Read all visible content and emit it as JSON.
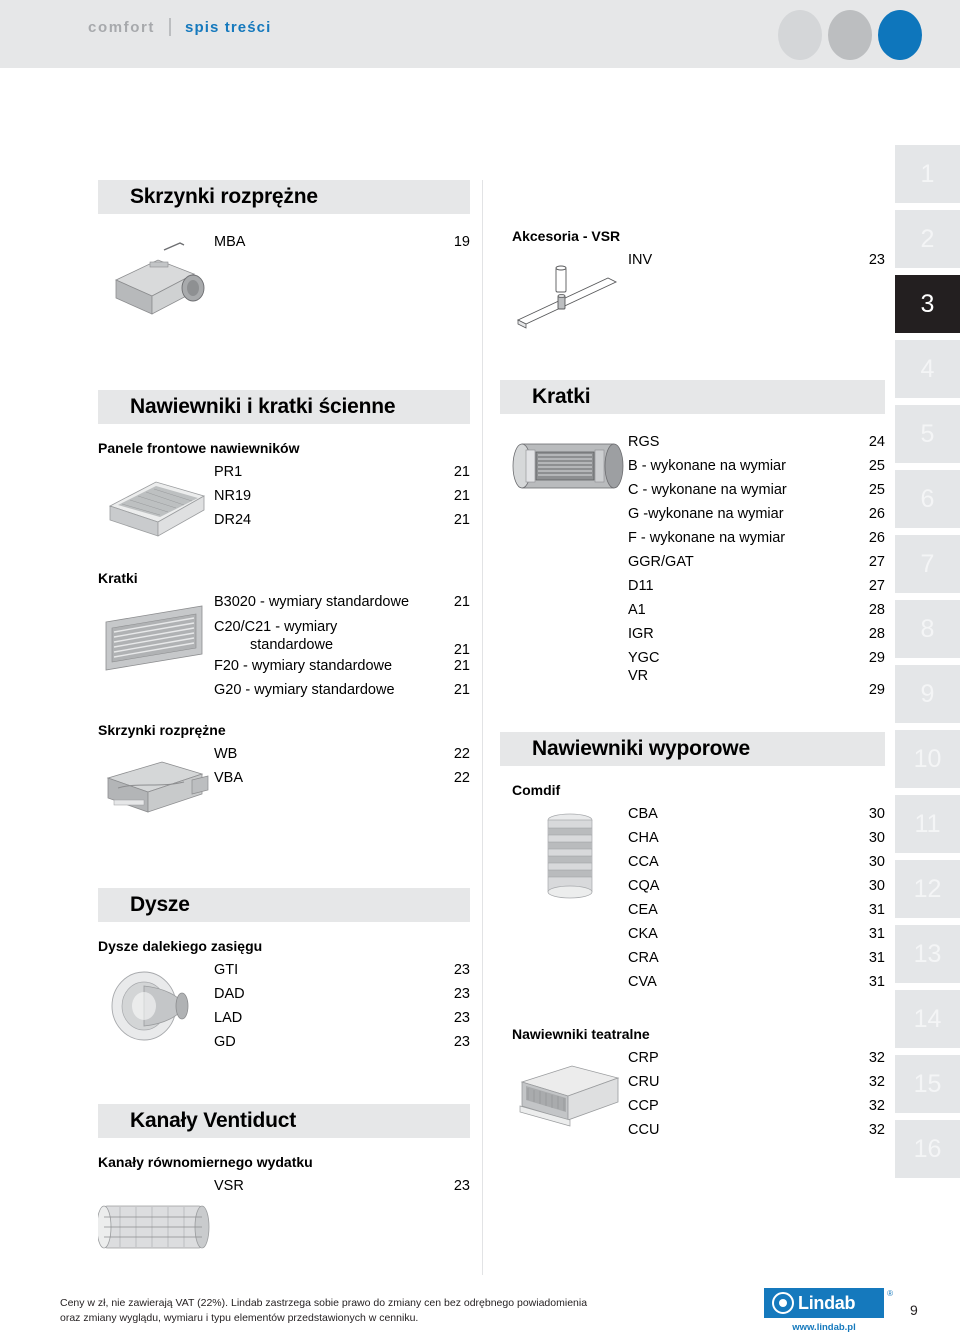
{
  "header": {
    "brand": "comfort",
    "section": "spis treści",
    "dots": [
      {
        "name": "dot-light",
        "color": "#d4d6d8"
      },
      {
        "name": "dot-medium",
        "color": "#bcbec0"
      },
      {
        "name": "dot-blue",
        "color": "#0e76bc"
      }
    ]
  },
  "left_column": [
    {
      "band": "Skrzynki rozprężne",
      "groups": [
        {
          "subhead": null,
          "thumb": "plenum-box-thumb",
          "items": [
            {
              "label": "MBA",
              "page": "19"
            }
          ]
        }
      ]
    },
    {
      "band": "Nawiewniki i kratki ścienne",
      "groups": [
        {
          "subhead": "Panele frontowe nawiewników",
          "thumb": "front-panel-thumb",
          "items": [
            {
              "label": "PR1",
              "page": "21"
            },
            {
              "label": "NR19",
              "page": "21"
            },
            {
              "label": "DR24",
              "page": "21"
            }
          ]
        },
        {
          "subhead": "Kratki",
          "thumb": "wall-grille-thumb",
          "items": [
            {
              "label": "B3020 - wymiary standardowe",
              "page": "21"
            },
            {
              "label": "C20/C21 - wymiary",
              "label_cont": "standardowe",
              "page": "21"
            },
            {
              "label": "F20 - wymiary standardowe",
              "page": "21"
            },
            {
              "label": "G20 - wymiary standardowe",
              "page": "21"
            }
          ]
        },
        {
          "subhead": "Skrzynki rozprężne",
          "thumb": "plenum-box-flat-thumb",
          "items": [
            {
              "label": "WB",
              "page": "22"
            },
            {
              "label": "VBA",
              "page": "22"
            }
          ]
        }
      ]
    },
    {
      "band": "Dysze",
      "groups": [
        {
          "subhead": "Dysze dalekiego zasięgu",
          "thumb": "nozzle-thumb",
          "items": [
            {
              "label": "GTI",
              "page": "23"
            },
            {
              "label": "DAD",
              "page": "23"
            },
            {
              "label": "LAD",
              "page": "23"
            },
            {
              "label": "GD",
              "page": "23"
            }
          ]
        }
      ]
    },
    {
      "band": "Kanały Ventiduct",
      "groups": [
        {
          "subhead": "Kanały równomiernego wydatku",
          "thumb": "textile-duct-thumb",
          "items": [
            {
              "label": "VSR",
              "page": "23"
            }
          ]
        }
      ]
    }
  ],
  "right_column": [
    {
      "band": null,
      "groups": [
        {
          "subhead": "Akcesoria - VSR",
          "thumb": "rail-accessory-thumb",
          "items": [
            {
              "label": "INV",
              "page": "23"
            }
          ]
        }
      ]
    },
    {
      "band": "Kratki",
      "groups": [
        {
          "subhead": null,
          "thumb": "round-duct-grille-thumb",
          "items": [
            {
              "label": "RGS",
              "page": "24"
            },
            {
              "label": "B - wykonane na wymiar",
              "page": "25"
            },
            {
              "label": "C - wykonane na wymiar",
              "page": "25"
            },
            {
              "label": "G -wykonane na wymiar",
              "page": "26"
            },
            {
              "label": "F - wykonane na wymiar",
              "page": "26"
            },
            {
              "label": "GGR/GAT",
              "page": "27"
            },
            {
              "label": "D11",
              "page": "27"
            },
            {
              "label": "A1",
              "page": "28"
            },
            {
              "label": "IGR",
              "page": "28"
            },
            {
              "label": "YGC",
              "page": "29"
            },
            {
              "label": "VR",
              "page": "29"
            }
          ]
        }
      ]
    },
    {
      "band": "Nawiewniki wyporowe",
      "groups": [
        {
          "subhead": "Comdif",
          "thumb": "displacement-diffuser-thumb",
          "items": [
            {
              "label": "CBA",
              "page": "30"
            },
            {
              "label": "CHA",
              "page": "30"
            },
            {
              "label": "CCA",
              "page": "30"
            },
            {
              "label": "CQA",
              "page": "30"
            },
            {
              "label": "CEA",
              "page": "31"
            },
            {
              "label": "CKA",
              "page": "31"
            },
            {
              "label": "CRA",
              "page": "31"
            },
            {
              "label": "CVA",
              "page": "31"
            }
          ]
        },
        {
          "subhead": "Nawiewniki teatralne",
          "thumb": "theatre-diffuser-thumb",
          "items": [
            {
              "label": "CRP",
              "page": "32"
            },
            {
              "label": "CRU",
              "page": "32"
            },
            {
              "label": "CCP",
              "page": "32"
            },
            {
              "label": "CCU",
              "page": "32"
            }
          ]
        }
      ]
    }
  ],
  "tabs": {
    "active": "3",
    "items": [
      "1",
      "2",
      "3",
      "4",
      "5",
      "6",
      "7",
      "8",
      "9",
      "10",
      "11",
      "12",
      "13",
      "14",
      "15",
      "16"
    ]
  },
  "footer": {
    "note_line1": "Ceny w zł, nie zawierają VAT (22%). Lindab zastrzega sobie prawo do zmiany cen bez odrębnego powiadomienia",
    "note_line2": "oraz zmiany wyglądu, wymiaru i typu elementów przedstawionych w cenniku.",
    "logo_text": "Lindab",
    "logo_reg": "®",
    "logo_url": "www.lindab.pl",
    "folio": "9"
  },
  "colors": {
    "accent_blue": "#1579bd",
    "band_gray": "#e6e7e8",
    "tab_gray": "#e4e6e8",
    "tab_active": "#231f20"
  }
}
